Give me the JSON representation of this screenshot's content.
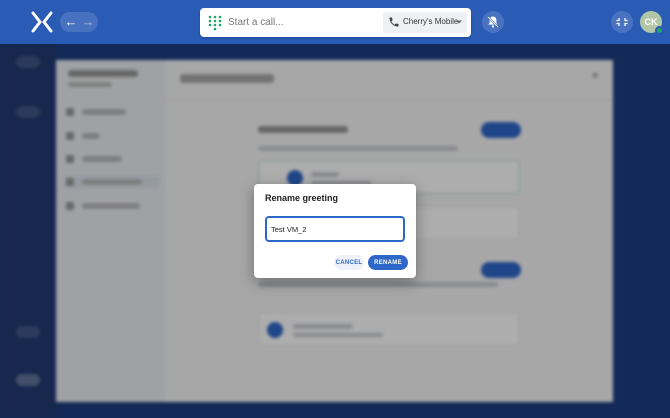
{
  "topbar": {
    "logo_icon": "x-logo-icon",
    "back_icon": "arrow-left-icon",
    "forward_icon": "arrow-right-icon",
    "call_placeholder": "Start a call...",
    "line_name": "Cherry's Mobile",
    "avatar_initials": "CK",
    "colors": {
      "bar": "#2a5bb5",
      "presence": "#21a366"
    }
  },
  "modal": {
    "title": "Rename greeting",
    "input_value": "Test VM_2",
    "cancel_label": "CANCEL",
    "rename_label": "RENAME",
    "accent": "#2f67c9"
  }
}
